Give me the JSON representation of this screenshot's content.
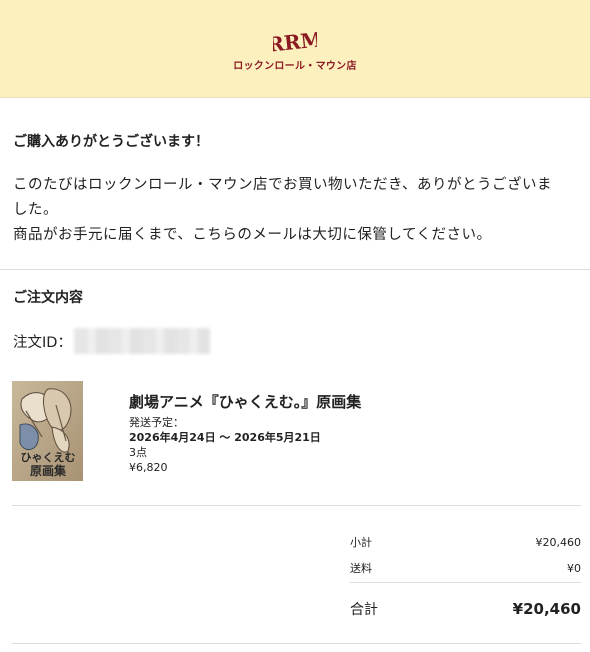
{
  "header": {
    "logo_mark": "RRM",
    "shop_name": "ロックンロール・マウン店",
    "bg_color": "#fdf0bf",
    "brand_color": "#8b1a22"
  },
  "thanks": {
    "title": "ご購入ありがとうございます！",
    "body_line1": "このたびはロックンロール・マウン店でお買い物いただき、ありがとうございま",
    "body_line2": "した。",
    "body_line3": "商品がお手元に届くまで、こちらのメールは大切に保管してください。"
  },
  "order": {
    "title": "ご注文内容",
    "id_label": "注文ID：",
    "item": {
      "cover_icon": "book-cover-image",
      "cover_text": "ひゃくえむ 原画集",
      "name": "劇場アニメ『ひゃくえむ。』原画集",
      "ship_label": "発送予定：",
      "ship_dates": "2026年4月24日 〜 2026年5月21日",
      "quantity": "3点",
      "price": "¥6,820"
    }
  },
  "totals": {
    "subtotal_label": "小計",
    "subtotal_value": "¥20,460",
    "shipping_label": "送料",
    "shipping_value": "¥0",
    "total_label": "合計",
    "total_value": "¥20,460"
  }
}
